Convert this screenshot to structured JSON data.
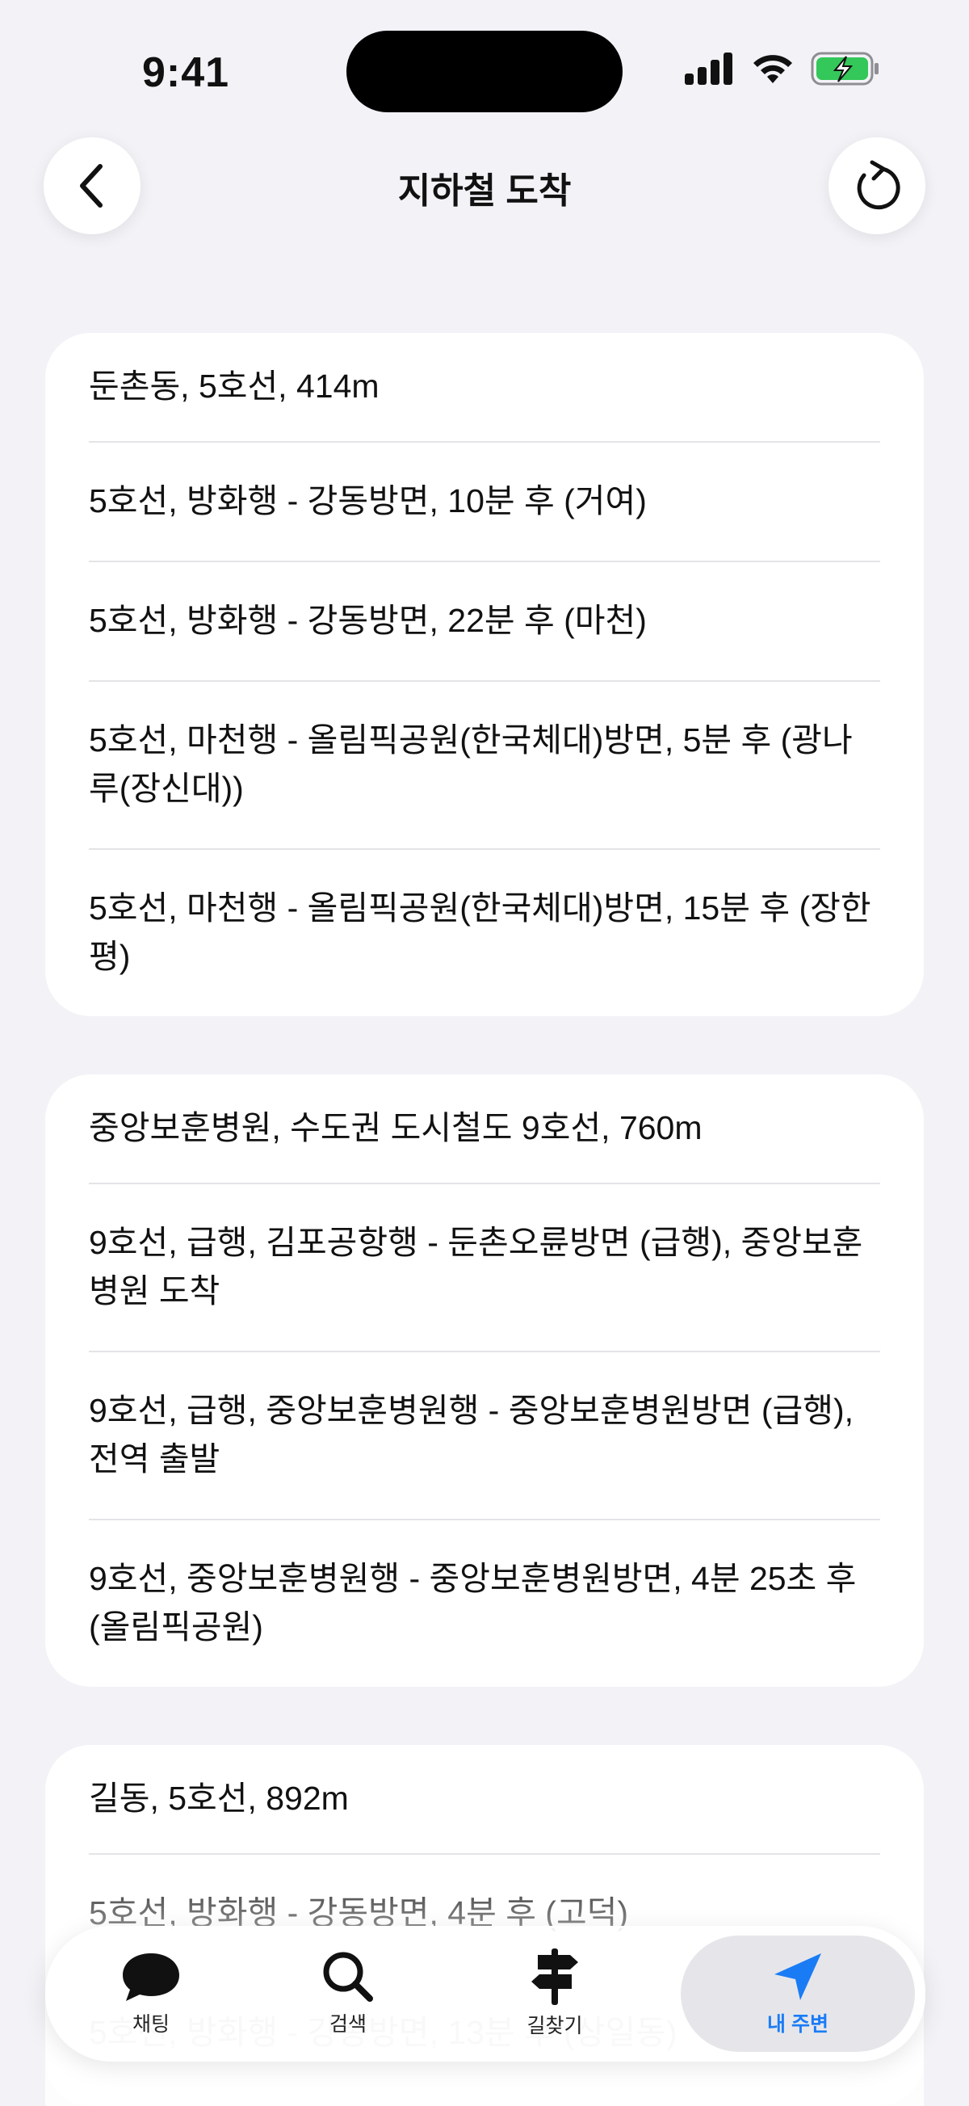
{
  "status": {
    "time": "9:41"
  },
  "header": {
    "title": "지하철 도착"
  },
  "cards": [
    {
      "rows": [
        "둔촌동, 5호선, 414m",
        "5호선, 방화행 - 강동방면, 10분 후 (거여)",
        "5호선, 방화행 - 강동방면, 22분 후 (마천)",
        "5호선, 마천행 - 올림픽공원(한국체대)방면, 5분 후 (광나루(장신대))",
        "5호선, 마천행 - 올림픽공원(한국체대)방면, 15분 후 (장한평)"
      ]
    },
    {
      "rows": [
        "중앙보훈병원, 수도권  도시철도 9호선, 760m",
        "9호선, 급행, 김포공항행 - 둔촌오륜방면 (급행), 중앙보훈병원 도착",
        "9호선, 급행, 중앙보훈병원행 - 중앙보훈병원방면 (급행), 전역 출발",
        "9호선, 중앙보훈병원행 - 중앙보훈병원방면, 4분 25초 후 (올림픽공원)"
      ]
    },
    {
      "rows": [
        "길동, 5호선, 892m",
        "5호선, 방화행 - 강동방면, 4분 후 (고덕)",
        "5호선, 방화행 - 강동방면, 13분 후 (상일동)"
      ]
    }
  ],
  "tabs": [
    {
      "label": "채팅",
      "icon": "chat-bubble-icon"
    },
    {
      "label": "검색",
      "icon": "search-icon"
    },
    {
      "label": "길찾기",
      "icon": "signpost-icon"
    },
    {
      "label": "내 주변",
      "icon": "location-arrow-icon",
      "active": true
    }
  ],
  "colors": {
    "accent": "#1a7cf5",
    "background": "#f2f2f7",
    "battery": "#34c759"
  }
}
